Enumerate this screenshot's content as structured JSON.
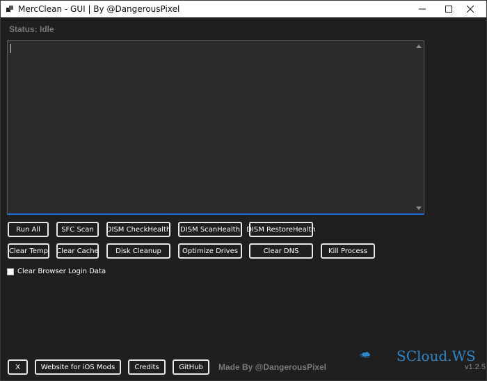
{
  "window": {
    "title": "MercClean - GUI | By @DangerousPixel"
  },
  "status": {
    "text": "Status: Idle"
  },
  "row1": [
    "Run All",
    "SFC Scan",
    "DISM CheckHealth",
    "DISM ScanHealth",
    "DISM RestoreHealth"
  ],
  "row2": [
    "Clear Temp",
    "Clear Cache",
    "Disk Cleanup",
    "Optimize Drives",
    "Clear DNS",
    "Kill Process"
  ],
  "checkbox": {
    "label": "Clear Browser Login Data",
    "checked": false
  },
  "footer": {
    "buttons": [
      "X",
      "Website for iOS Mods",
      "Credits",
      "GitHub"
    ],
    "made_by": "Made By @DangerousPixel",
    "version": "v1.2.5"
  },
  "watermark": {
    "text": "SCloud.WS"
  },
  "colors": {
    "background": "#1f1f1f",
    "console_bg": "#2b2b2b",
    "accent": "#1e6fd9",
    "watermark": "#2f86c8"
  }
}
